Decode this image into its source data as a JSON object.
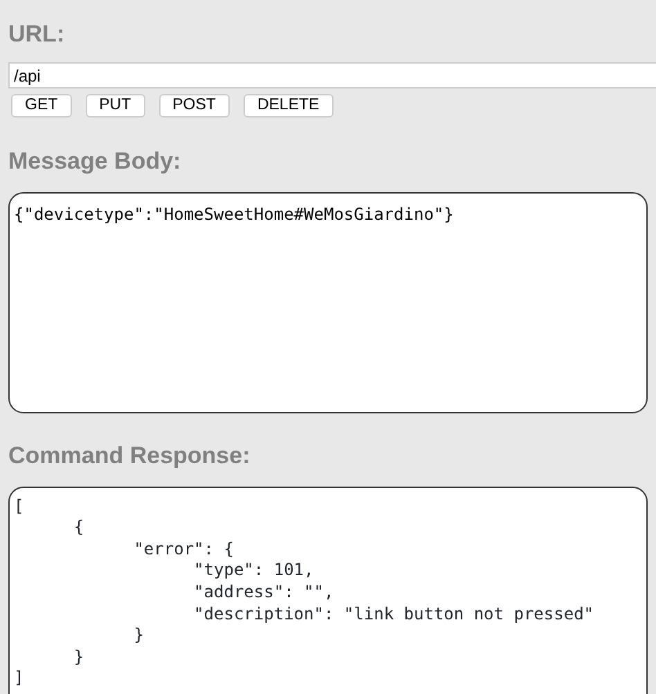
{
  "url_section": {
    "heading": "URL:",
    "url_value": "/api",
    "buttons": [
      "GET",
      "PUT",
      "POST",
      "DELETE"
    ]
  },
  "message_body": {
    "heading": "Message Body:",
    "value": "{\"devicetype\":\"HomeSweetHome#WeMosGiardino\"}"
  },
  "command_response": {
    "heading": "Command Response:",
    "value": "[\n\t{\n\t\t\"error\": {\n\t\t\t\"type\": 101,\n\t\t\t\"address\": \"\",\n\t\t\t\"description\": \"link button not pressed\"\n\t\t}\n\t}\n]"
  }
}
